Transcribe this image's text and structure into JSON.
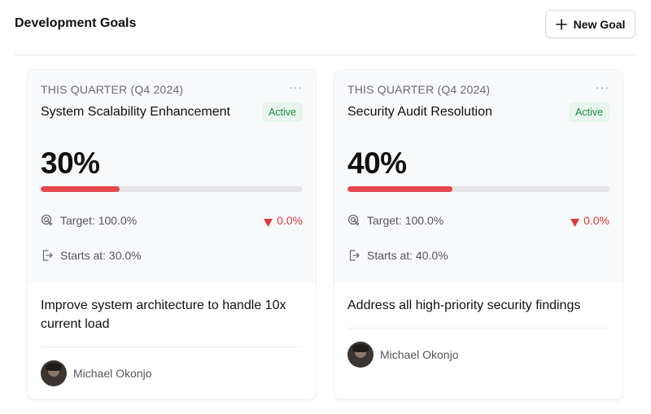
{
  "header": {
    "title": "Development Goals",
    "new_goal_label": "New Goal"
  },
  "colors": {
    "progress_fill": "#e5484d",
    "progress_track": "#e5e5e8",
    "status_bg": "#e7f6ec",
    "status_text": "#1f8a45",
    "delta_negative": "#d93b3b"
  },
  "goals": [
    {
      "period": "THIS QUARTER (Q4 2024)",
      "more": "···",
      "title": "System Scalability Enhancement",
      "status": "Active",
      "percent_label": "30%",
      "progress": 0.3,
      "target": "Target: 100.0%",
      "delta": "0.0%",
      "starts": "Starts at: 30.0%",
      "description": "Improve system architecture to handle 10x current load",
      "owner": "Michael Okonjo"
    },
    {
      "period": "THIS QUARTER (Q4 2024)",
      "more": "···",
      "title": "Security Audit Resolution",
      "status": "Active",
      "percent_label": "40%",
      "progress": 0.4,
      "target": "Target: 100.0%",
      "delta": "0.0%",
      "starts": "Starts at: 40.0%",
      "description": "Address all high-priority security findings",
      "owner": "Michael Okonjo"
    }
  ],
  "icons": {
    "add": "plus-icon",
    "target": "target-icon",
    "starts": "sign-in-icon",
    "delta": "triangle-down-icon",
    "more": "more-horizontal-icon"
  }
}
